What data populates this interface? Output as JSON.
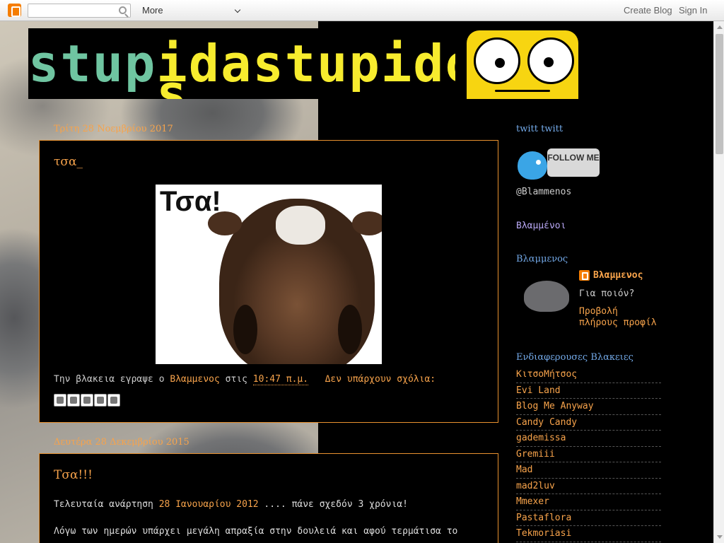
{
  "navbar": {
    "more_label": "More",
    "create_blog": "Create Blog",
    "sign_in": "Sign In"
  },
  "header": {
    "title_parts": [
      "stup",
      "i",
      "s",
      "dastupi",
      "does"
    ]
  },
  "posts": [
    {
      "date": "Τρίτη 28 Νοεμβρίου 2017",
      "title": "τσα_",
      "image_caption": "Τσα!",
      "footer_prefix": "Την βλακεια εγραψε ο ",
      "author": "Βλαμμενος",
      "time_prefix": " στις ",
      "time": "10:47 π.μ.",
      "comments": "Δεν υπάρχουν σχόλια:"
    },
    {
      "date": "Δευτέρα 28 Δεκεμβρίου 2015",
      "title": "Τσα!!!",
      "body_line1_prefix": "Τελευταία ανάρτηση ",
      "body_line1_link": "28 Ιανουαρίου 2012",
      "body_line1_suffix": " .... πάνε σχεδόν 3 χρόνια!",
      "body_line2": "Λόγω των ημερών υπάρχει μεγάλη απραξία στην δουλειά και αφού τερμάτισα το"
    }
  ],
  "sidebar": {
    "twitt_title": "twitt twitt",
    "follow_me": "FOLLOW ME",
    "twitter_handle": "@Blammenos",
    "vlammenoi_link": "Βλαμμένοι",
    "profile_widget_title": "Βλαμμενος",
    "profile_name": "Βλαμμενος",
    "profile_about": "Για ποιόν?",
    "profile_view_line1": "Προβολή",
    "profile_view_line2": "πλήρους προφίλ",
    "blogroll_title": "Ενδιαφερουσες Βλακειες",
    "blogroll": [
      "ΚιτσοΜήτσος",
      "Evi Land",
      "Blog Me Anyway",
      "Candy Candy",
      "gademissa",
      "Gremiii",
      "Mad",
      "mad2luv",
      "Mmexer",
      "Pastaflora",
      "Tekmoriasi"
    ]
  }
}
